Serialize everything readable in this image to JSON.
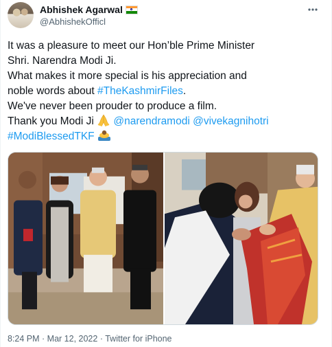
{
  "author": {
    "display_name": "Abhishek Agarwal",
    "handle": "@AbhishekOfficl",
    "badge": "india-flag-icon",
    "more_icon": "more-icon"
  },
  "tweet": {
    "line1": "It was a pleasure to meet our Hon’ble Prime Minister",
    "line2": "Shri. Narendra Modi Ji.",
    "line3": "What makes it more special is his appreciation and",
    "line4_prefix": "noble words about ",
    "hashtag_kashmir": "#TheKashmirFiles",
    "line4_suffix": ".",
    "line5": "We've never been prouder to produce a film.",
    "line6_prefix": "Thank you Modi Ji ",
    "mention_modi": "@narendramodi",
    "mention_vivek": "@vivekagnihotri",
    "hashtag_modi": "#ModiBlessedTKF",
    "emoji_pray": "folded-hands-icon",
    "emoji_bow": "person-bowing-icon"
  },
  "media": {
    "photo_left": "group-photo",
    "photo_right": "felicitation-photo"
  },
  "footer": {
    "time": "8:24 PM",
    "sep1": " · ",
    "date": "Mar 12, 2022",
    "sep2": " · ",
    "source": "Twitter for iPhone"
  },
  "colors": {
    "link": "#1d9bf0",
    "text": "#0f1419",
    "muted": "#536471"
  }
}
